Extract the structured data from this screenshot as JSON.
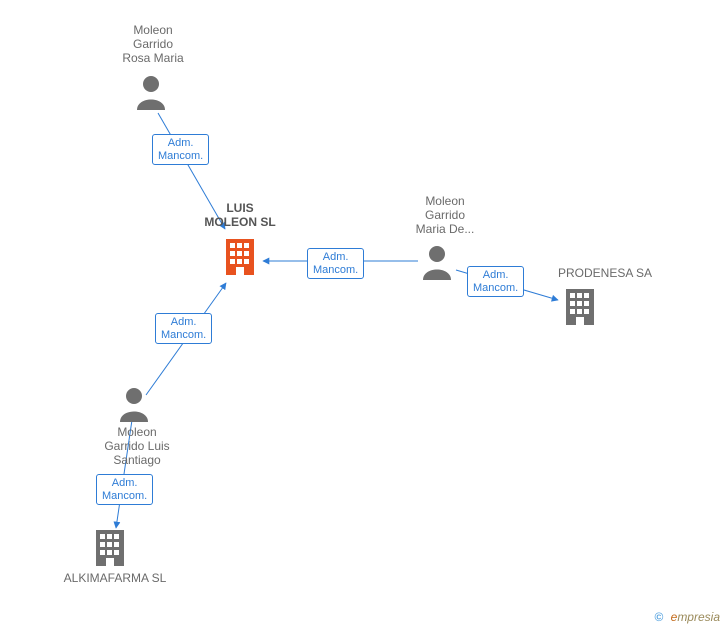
{
  "nodes": {
    "rosa": {
      "label": "Moleon\nGarrido\nRosa Maria"
    },
    "luis_co": {
      "label": "LUIS\nMOLEON SL"
    },
    "maria": {
      "label": "Moleon\nGarrido\nMaria De..."
    },
    "prodenesa": {
      "label": "PRODENESA SA"
    },
    "luis_p": {
      "label": "Moleon\nGarrido Luis\nSantiago"
    },
    "alkima": {
      "label": "ALKIMAFARMA SL"
    }
  },
  "edges": {
    "e1": {
      "label": "Adm.\nMancom."
    },
    "e2": {
      "label": "Adm.\nMancom."
    },
    "e3": {
      "label": "Adm.\nMancom."
    },
    "e4": {
      "label": "Adm.\nMancom."
    },
    "e5": {
      "label": "Adm.\nMancom."
    }
  },
  "watermark": {
    "copyright": "©",
    "brand_e": "e",
    "brand_rest": "mpresia"
  }
}
